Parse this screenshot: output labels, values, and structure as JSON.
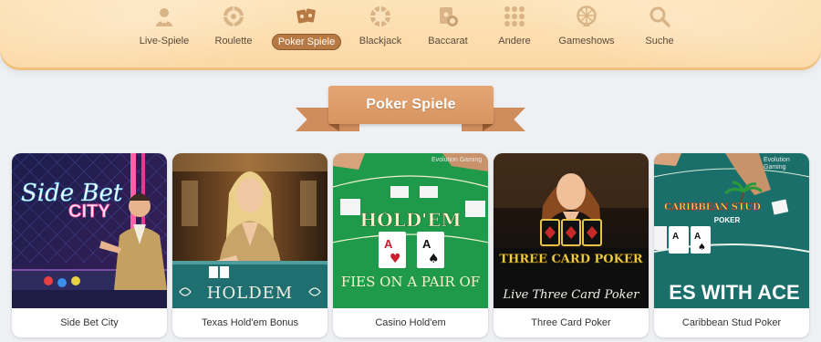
{
  "nav": {
    "items": [
      {
        "label": "Live-Spiele",
        "icon": "dealer-icon",
        "active": false
      },
      {
        "label": "Roulette",
        "icon": "roulette-wheel-icon",
        "active": false
      },
      {
        "label": "Poker Spiele",
        "icon": "playing-cards-icon",
        "active": true
      },
      {
        "label": "Blackjack",
        "icon": "poker-chip-icon",
        "active": false
      },
      {
        "label": "Baccarat",
        "icon": "card-stack-icon",
        "active": false
      },
      {
        "label": "Andere",
        "icon": "dots-grid-icon",
        "active": false
      },
      {
        "label": "Gameshows",
        "icon": "money-wheel-icon",
        "active": false
      },
      {
        "label": "Suche",
        "icon": "search-icon",
        "active": false
      }
    ]
  },
  "section": {
    "title": "Poker Spiele"
  },
  "games": [
    {
      "name": "Side Bet City",
      "art_title": "Side Bet",
      "art_subtitle": "CITY"
    },
    {
      "name": "Texas Hold'em Bonus",
      "art_title": "HOLDEM"
    },
    {
      "name": "Casino Hold'em",
      "art_title": "HOLD'EM",
      "art_subtitle": "FIES ON A PAIR OF",
      "provider": "Evolution Gaming"
    },
    {
      "name": "Three Card Poker",
      "art_title": "THREE CARD POKER",
      "art_subtitle": "Live Three Card Poker"
    },
    {
      "name": "Caribbean Stud Poker",
      "art_title": "CARIBBEAN STUD",
      "art_subtitle": "POKER",
      "art_text": "ES WITH ACE",
      "provider": "Evolution Gaming"
    }
  ],
  "colors": {
    "nav_bg": "#fbd9a6",
    "active_pill": "#b77a45",
    "ribbon": "#d8955f",
    "page_bg": "#eef0f3"
  }
}
